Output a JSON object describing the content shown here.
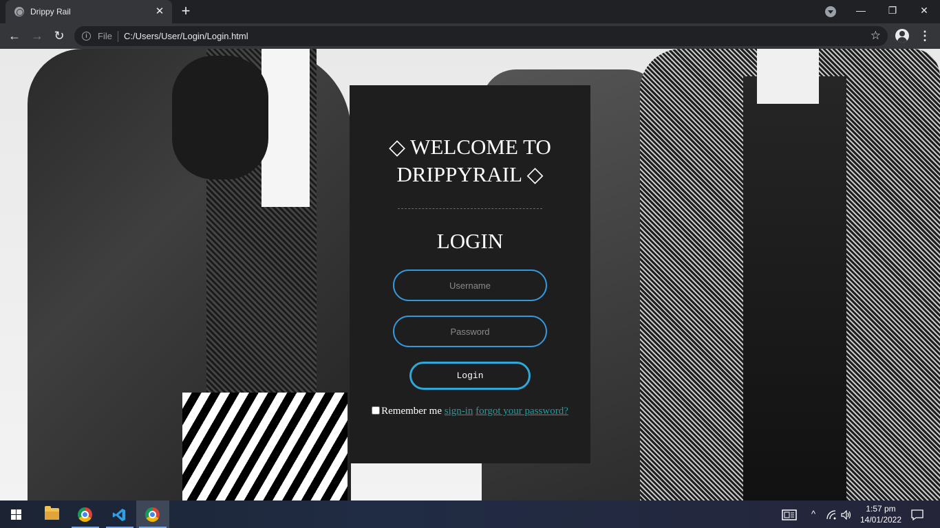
{
  "browser": {
    "tab_title": "Drippy Rail",
    "tab_close": "✕",
    "new_tab": "+",
    "window_controls": {
      "minimize": "—",
      "restore": "❐",
      "close": "✕"
    },
    "nav": {
      "back": "←",
      "forward": "→",
      "reload": "↻"
    },
    "omnibox": {
      "scheme_label": "File",
      "url": "C:/Users/User/Login/Login.html",
      "info_glyph": "i"
    },
    "star": "☆",
    "menu": "⋮"
  },
  "page": {
    "welcome_text": "◇ WELCOME TO DRIPPYRAIL ◇",
    "login_heading": "LOGIN",
    "username_placeholder": "Username",
    "password_placeholder": "Password",
    "login_button": "Login",
    "remember_label": "Remember me",
    "signin_link": "sign-in",
    "forgot_link": "forgot your password?"
  },
  "taskbar": {
    "time": "1:57 pm",
    "date": "14/01/2022",
    "tray_chevron": "^",
    "notification": "🗨"
  },
  "colors": {
    "accent_blue": "#3498db",
    "link_teal": "#1e9e9e",
    "card_bg": "#1e1e1f"
  }
}
